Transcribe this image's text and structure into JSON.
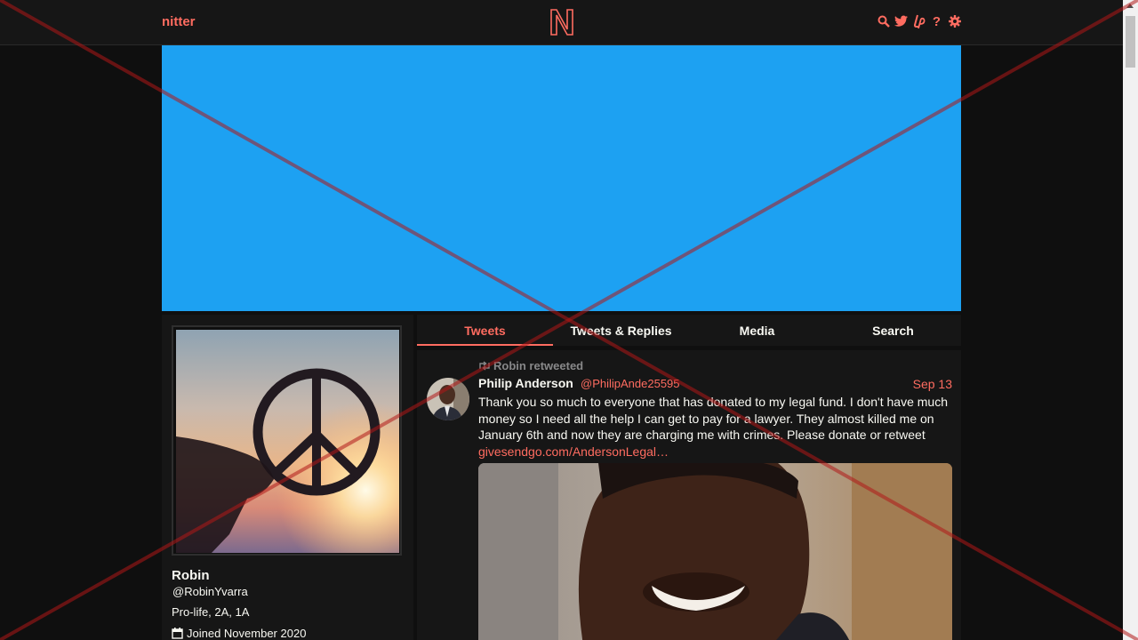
{
  "navbar": {
    "site_name": "nitter",
    "icons": [
      "search-icon",
      "twitter-icon",
      "liberapay-icon",
      "help-icon",
      "settings-icon"
    ],
    "help_glyph": "?"
  },
  "banner": {
    "color": "#1da1f2"
  },
  "profile": {
    "name": "Robin",
    "handle": "@RobinYvarra",
    "bio": "Pro-life, 2A, 1A",
    "joined": "Joined November 2020"
  },
  "tabs": [
    {
      "label": "Tweets",
      "active": true
    },
    {
      "label": "Tweets & Replies",
      "active": false
    },
    {
      "label": "Media",
      "active": false
    },
    {
      "label": "Search",
      "active": false
    }
  ],
  "tweet": {
    "retweet_header": "Robin retweeted",
    "author": "Philip Anderson",
    "username": "@PhilipAnde25595",
    "date": "Sep 13",
    "text": "Thank you so much to everyone that has donated to my legal fund. I don't have much money so I need all the help I can get to pay for a lawyer. They almost killed me on January 6th and now they are charging me with crimes. Please donate or retweet",
    "link": "givesendgo.com/AndersonLegal…"
  },
  "colors": {
    "accent": "#ff6c60",
    "background": "#0f0f0f",
    "panel": "#161616",
    "text": "#f8f8f2",
    "muted": "#888889"
  }
}
